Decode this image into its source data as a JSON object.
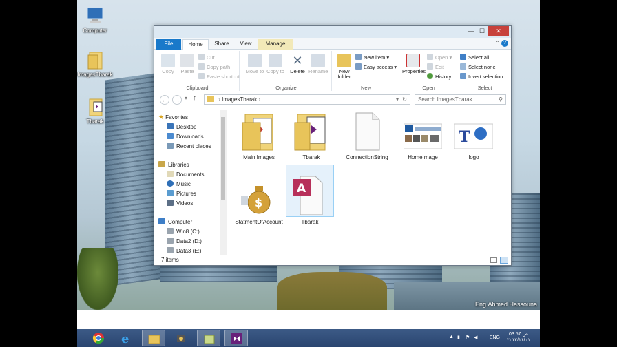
{
  "desktop": {
    "icons": [
      {
        "label": "Computer"
      },
      {
        "label": "ImagesTbarak"
      },
      {
        "label": "Tbarak"
      }
    ],
    "credit": "Eng.Ahmed Hassouna"
  },
  "window": {
    "tabs": {
      "file": "File",
      "home": "Home",
      "share": "Share",
      "view": "View",
      "manage": "Manage"
    },
    "clipboard": {
      "copy": "Copy",
      "paste": "Paste",
      "cut": "Cut",
      "copy_path": "Copy path",
      "paste_shortcut": "Paste shortcut",
      "label": "Clipboard"
    },
    "organize": {
      "move_to": "Move to",
      "copy_to": "Copy to",
      "delete": "Delete",
      "rename": "Rename",
      "label": "Organize"
    },
    "new": {
      "new_folder_1": "New",
      "new_folder_2": "folder",
      "new_item": "New item",
      "easy_access": "Easy access",
      "label": "New"
    },
    "open": {
      "properties": "Properties",
      "open": "Open",
      "edit": "Edit",
      "history": "History",
      "label": "Open"
    },
    "select": {
      "select_all": "Select all",
      "select_none": "Select none",
      "invert": "Invert selection",
      "label": "Select"
    },
    "address": {
      "path": "ImagesTbarak",
      "search_placeholder": "Search ImagesTbarak"
    },
    "nav": {
      "favorites": "Favorites",
      "desktop": "Desktop",
      "downloads": "Downloads",
      "recent": "Recent places",
      "libraries": "Libraries",
      "documents": "Documents",
      "music": "Music",
      "pictures": "Pictures",
      "videos": "Videos",
      "computer": "Computer",
      "c": "Win8 (C:)",
      "d": "Data2 (D:)",
      "e": "Data3 (E:)"
    },
    "files": [
      {
        "name": "Main Images"
      },
      {
        "name": "Tbarak"
      },
      {
        "name": "ConnectionString"
      },
      {
        "name": "HomeImage"
      },
      {
        "name": "logo"
      },
      {
        "name": "StatmentOfAccount"
      },
      {
        "name": "Tbarak"
      }
    ],
    "status": "7 items"
  },
  "taskbar": {
    "lang": "ENG",
    "time": "03:57 ص",
    "date": "٢٠١٣/١١/٠١"
  },
  "colors": {
    "accent": "#1979ca",
    "close": "#c7413b",
    "taskbar": "#2f4b78",
    "folder": "#e8c45a"
  }
}
